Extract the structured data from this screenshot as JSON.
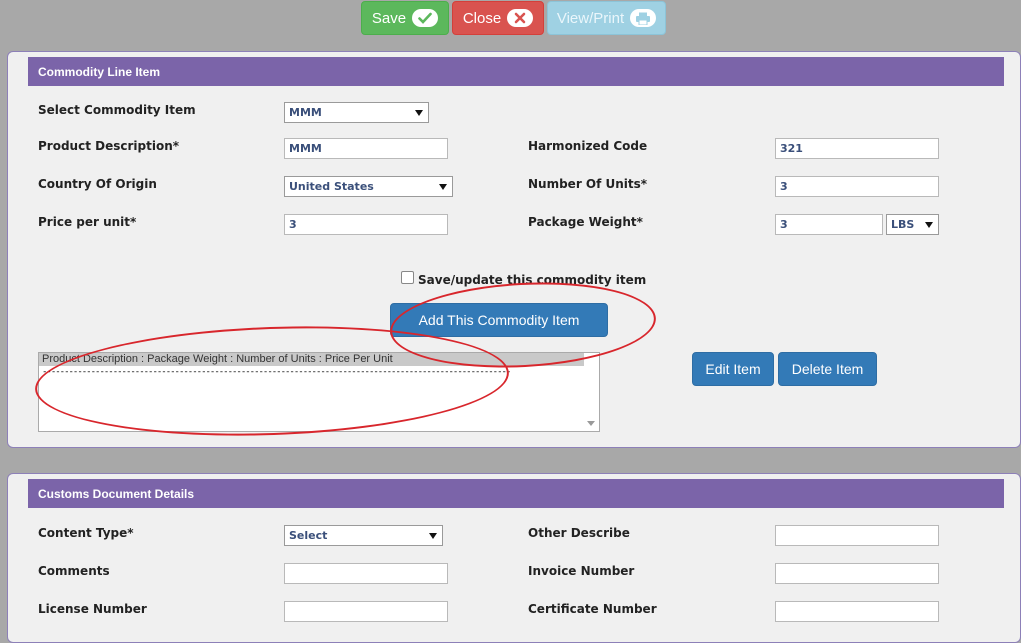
{
  "toolbar": {
    "save_label": "Save",
    "close_label": "Close",
    "view_print_label": "View/Print"
  },
  "commodity": {
    "header": "Commodity Line Item",
    "select_item_label": "Select Commodity Item",
    "select_item_value": "MMM",
    "product_desc_label": "Product Description*",
    "product_desc_value": "MMM",
    "harmonized_label": "Harmonized Code",
    "harmonized_value": "321",
    "country_label": "Country Of Origin",
    "country_value": "United States",
    "units_label": "Number Of Units*",
    "units_value": "3",
    "price_label": "Price per unit*",
    "price_value": "3",
    "weight_label": "Package Weight*",
    "weight_value": "3",
    "weight_unit": "LBS",
    "save_update_label": "Save/update this commodity item",
    "add_button": "Add This Commodity Item",
    "list_header": "Product Description : Package Weight : Number of Units : Price Per Unit",
    "list_separator": "----------------------------------------------------------------------------------------------------------",
    "edit_button": "Edit Item",
    "delete_button": "Delete Item"
  },
  "customs": {
    "header": "Customs Document Details",
    "content_type_label": "Content Type*",
    "content_type_value": "Select",
    "other_describe_label": "Other Describe",
    "comments_label": "Comments",
    "invoice_label": "Invoice Number",
    "license_label": "License Number",
    "certificate_label": "Certificate Number"
  },
  "colors": {
    "header_purple": "#7b64a9",
    "primary_blue": "#337ab7",
    "annotation_red": "#d8262c"
  }
}
